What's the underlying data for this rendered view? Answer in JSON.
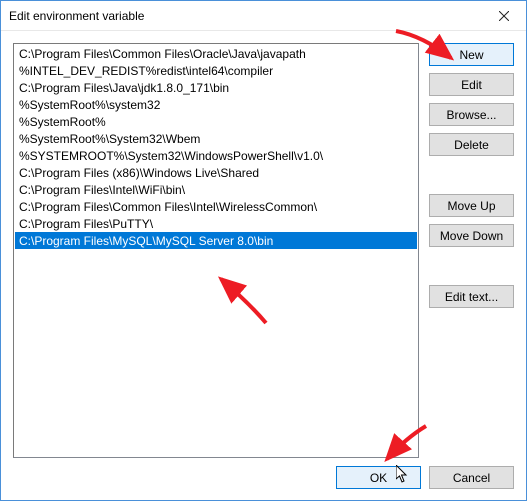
{
  "title": "Edit environment variable",
  "paths": [
    "C:\\Program Files\\Common Files\\Oracle\\Java\\javapath",
    "%INTEL_DEV_REDIST%redist\\intel64\\compiler",
    "C:\\Program Files\\Java\\jdk1.8.0_171\\bin",
    "%SystemRoot%\\system32",
    "%SystemRoot%",
    "%SystemRoot%\\System32\\Wbem",
    "%SYSTEMROOT%\\System32\\WindowsPowerShell\\v1.0\\",
    "C:\\Program Files (x86)\\Windows Live\\Shared",
    "C:\\Program Files\\Intel\\WiFi\\bin\\",
    "C:\\Program Files\\Common Files\\Intel\\WirelessCommon\\",
    "C:\\Program Files\\PuTTY\\",
    "C:\\Program Files\\MySQL\\MySQL Server 8.0\\bin"
  ],
  "selected_index": 11,
  "buttons": {
    "new": "New",
    "edit": "Edit",
    "browse": "Browse...",
    "delete": "Delete",
    "move_up": "Move Up",
    "move_down": "Move Down",
    "edit_text": "Edit text...",
    "ok": "OK",
    "cancel": "Cancel"
  },
  "annotations": {
    "arrow_color": "#ed1c24"
  }
}
